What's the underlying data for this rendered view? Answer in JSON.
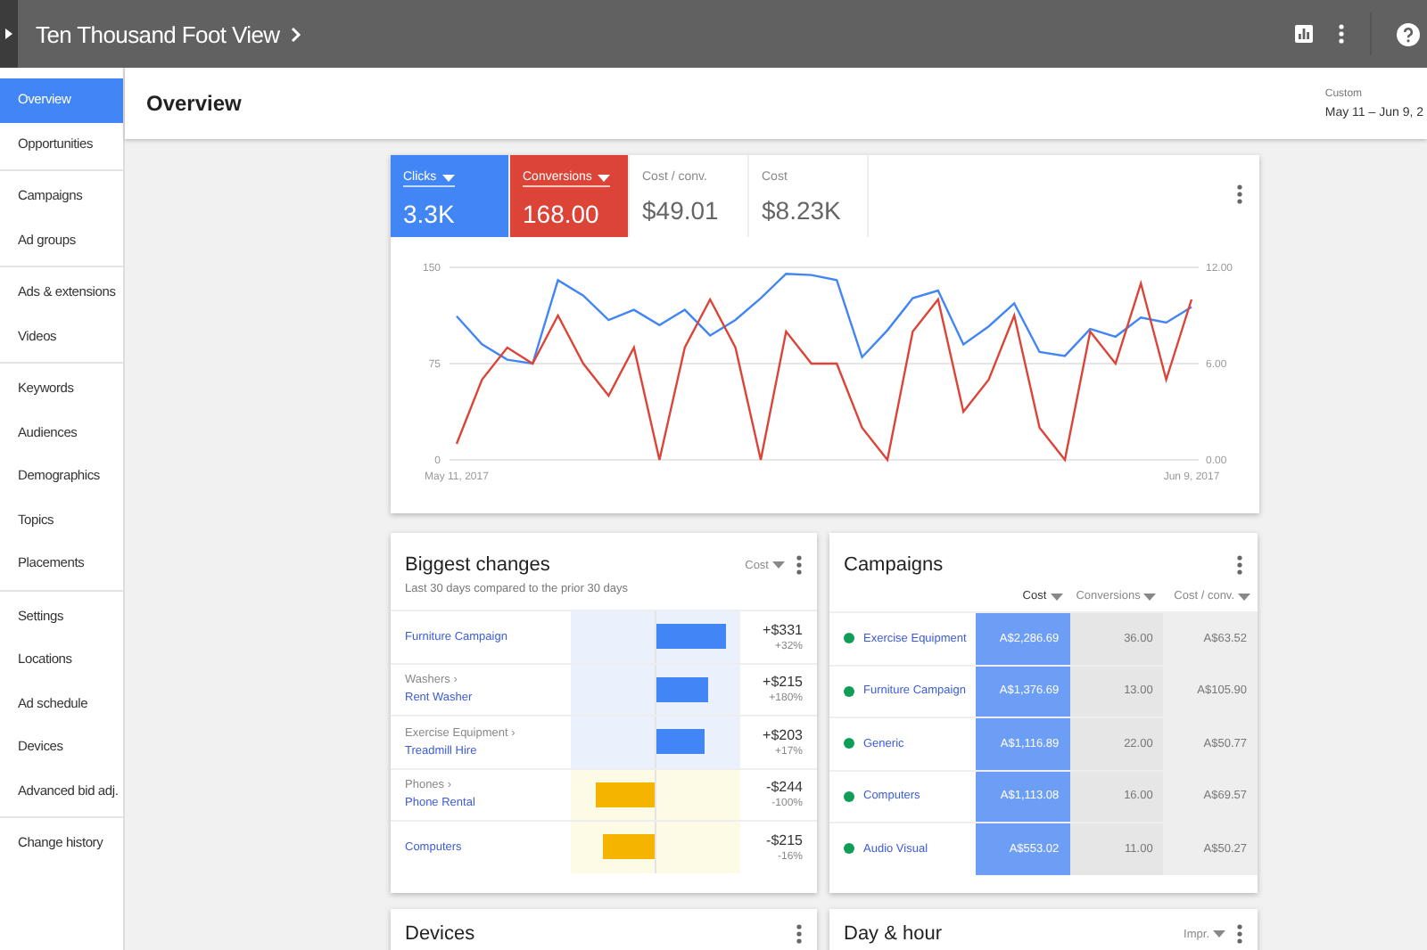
{
  "topbar": {
    "title": "Ten Thousand Foot View"
  },
  "sidebar": {
    "groups": [
      [
        {
          "label": "Overview",
          "selected": true
        },
        {
          "label": "Opportunities",
          "selected": false
        }
      ],
      [
        {
          "label": "Campaigns",
          "selected": false
        },
        {
          "label": "Ad groups",
          "selected": false
        }
      ],
      [
        {
          "label": "Ads & extensions",
          "selected": false
        },
        {
          "label": "Videos",
          "selected": false
        }
      ],
      [
        {
          "label": "Keywords",
          "selected": false
        },
        {
          "label": "Audiences",
          "selected": false
        },
        {
          "label": "Demographics",
          "selected": false
        },
        {
          "label": "Topics",
          "selected": false
        },
        {
          "label": "Placements",
          "selected": false
        }
      ],
      [
        {
          "label": "Settings",
          "selected": false
        },
        {
          "label": "Locations",
          "selected": false
        },
        {
          "label": "Ad schedule",
          "selected": false
        },
        {
          "label": "Devices",
          "selected": false
        },
        {
          "label": "Advanced bid adj.",
          "selected": false
        }
      ],
      [
        {
          "label": "Change history",
          "selected": false
        }
      ]
    ]
  },
  "header": {
    "title": "Overview",
    "range_label": "Custom",
    "range": "May 11 – Jun 9, 2"
  },
  "performance": {
    "metrics": [
      {
        "label": "Clicks",
        "value": "3.3K",
        "selected": true,
        "color": "#4285f4"
      },
      {
        "label": "Conversions",
        "value": "168.00",
        "selected": true,
        "color": "#db4437"
      },
      {
        "label": "Cost / conv.",
        "value": "$49.01",
        "selected": false,
        "color": "#ffffff"
      },
      {
        "label": "Cost",
        "value": "$8.23K",
        "selected": false,
        "color": "#ffffff"
      }
    ],
    "chart_data": {
      "type": "line",
      "categories": [
        "May 11, 2017",
        null,
        null,
        null,
        null,
        null,
        null,
        null,
        null,
        null,
        null,
        null,
        null,
        null,
        null,
        null,
        null,
        null,
        null,
        null,
        null,
        null,
        null,
        null,
        null,
        null,
        null,
        null,
        null,
        "Jun 9, 2017"
      ],
      "ylim": [
        0,
        150
      ],
      "yticks": [
        0,
        75,
        150
      ],
      "y2lim": [
        0,
        12
      ],
      "y2ticks": [
        {
          "value": 0,
          "label": "0.00"
        },
        {
          "value": 6,
          "label": "6.00"
        },
        {
          "value": 12,
          "label": "12.00"
        }
      ],
      "series": [
        {
          "color": "#4285f4",
          "axis": "y",
          "values": [
            112,
            90,
            78,
            75,
            140,
            128,
            109,
            117,
            105,
            117,
            97,
            109,
            126,
            145,
            144,
            140,
            80,
            101,
            126,
            132,
            90,
            104,
            122,
            84,
            81,
            102,
            96,
            111,
            107,
            119
          ]
        },
        {
          "color": "#db4437",
          "axis": "y2",
          "values": [
            1,
            5,
            7,
            6,
            9,
            6,
            4,
            7,
            0,
            7,
            10,
            7,
            0,
            8,
            6,
            6,
            2,
            0,
            8,
            10,
            3,
            5,
            9,
            2,
            0,
            8,
            6,
            11,
            5,
            10
          ]
        }
      ]
    }
  },
  "biggest_changes": {
    "title": "Biggest changes",
    "subtitle": "Last 30 days compared to the prior 30 days",
    "metric": "Cost",
    "rows": [
      {
        "name": "Furniture Campaign",
        "kind": "increase",
        "level": 0.83,
        "change": "+$331",
        "percent": "+32%"
      },
      {
        "parent": "Washers ›",
        "name": "Rent Washer",
        "kind": "increase",
        "level": 0.62,
        "change": "+$215",
        "percent": "+180%"
      },
      {
        "parent": "Exercise Equipment ›",
        "name": "Treadmill Hire",
        "kind": "increase",
        "level": 0.57,
        "change": "+$203",
        "percent": "+17%"
      },
      {
        "parent": "Phones ›",
        "name": "Phone Rental",
        "kind": "decrease",
        "level": 0.7,
        "change": "-$244",
        "percent": "-100%"
      },
      {
        "name": "Computers",
        "kind": "decrease",
        "level": 0.62,
        "change": "-$215",
        "percent": "-16%"
      }
    ]
  },
  "campaigns": {
    "title": "Campaigns",
    "columns": [
      {
        "label": "Cost",
        "selected": true
      },
      {
        "label": "Conversions",
        "selected": false
      },
      {
        "label": "Cost / conv.",
        "selected": false
      }
    ],
    "rows": [
      {
        "name": "Exercise Equipment",
        "color": "#0f9d58",
        "cells": [
          "A$2,286.69",
          "36.00",
          "A$63.52"
        ]
      },
      {
        "name": "Furniture Campaign",
        "color": "#0f9d58",
        "cells": [
          "A$1,376.69",
          "13.00",
          "A$105.90"
        ]
      },
      {
        "name": "Generic",
        "color": "#0f9d58",
        "cells": [
          "A$1,116.89",
          "22.00",
          "A$50.77"
        ]
      },
      {
        "name": "Computers",
        "color": "#0f9d58",
        "cells": [
          "A$1,113.08",
          "16.00",
          "A$69.57"
        ]
      },
      {
        "name": "Audio Visual",
        "color": "#0f9d58",
        "cells": [
          "A$553.02",
          "11.00",
          "A$50.27"
        ]
      }
    ]
  },
  "devices": {
    "title": "Devices"
  },
  "day_hour": {
    "title": "Day & hour",
    "metric": "Impr."
  }
}
